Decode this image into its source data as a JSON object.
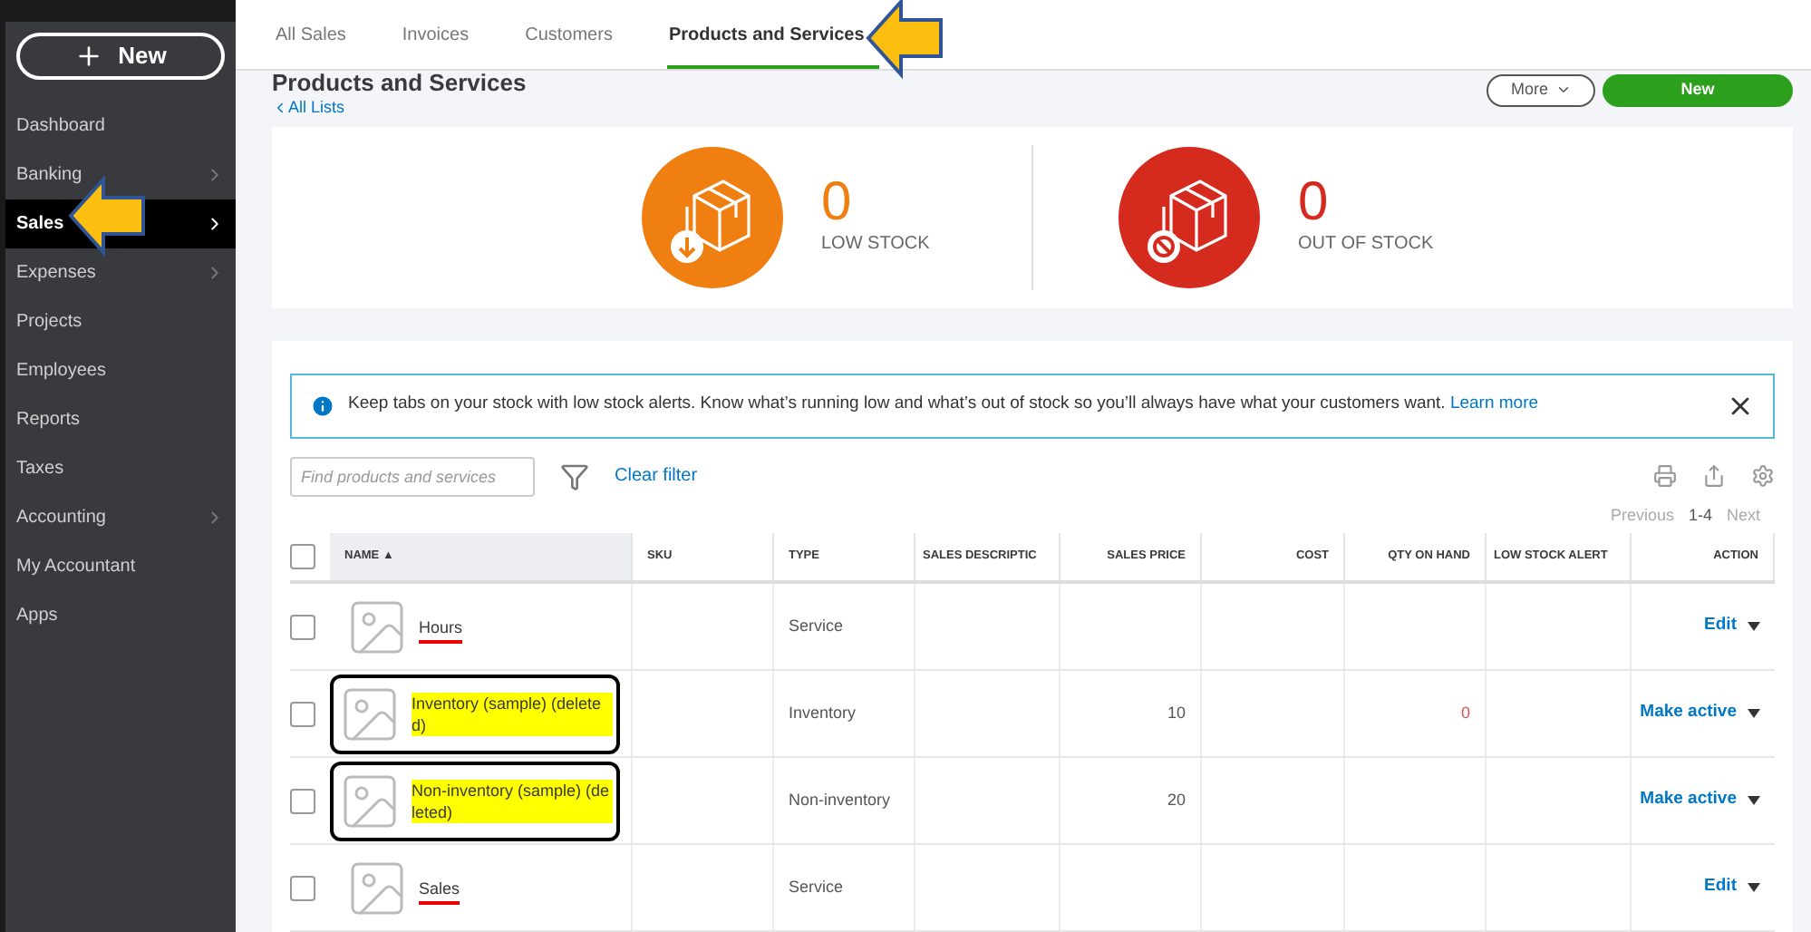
{
  "sidebar": {
    "new_button": "New",
    "items": [
      {
        "label": "Dashboard",
        "selected": false,
        "has_submenu": false,
        "arrow": false
      },
      {
        "label": "Banking",
        "selected": false,
        "has_submenu": true,
        "arrow": false
      },
      {
        "label": "Sales",
        "selected": true,
        "has_submenu": true,
        "arrow": true
      },
      {
        "label": "Expenses",
        "selected": false,
        "has_submenu": true,
        "arrow": false
      },
      {
        "label": "Projects",
        "selected": false,
        "has_submenu": false,
        "arrow": false
      },
      {
        "label": "Employees",
        "selected": false,
        "has_submenu": false,
        "arrow": false
      },
      {
        "label": "Reports",
        "selected": false,
        "has_submenu": false,
        "arrow": false
      },
      {
        "label": "Taxes",
        "selected": false,
        "has_submenu": false,
        "arrow": false
      },
      {
        "label": "Accounting",
        "selected": false,
        "has_submenu": true,
        "arrow": false
      },
      {
        "label": "My Accountant",
        "selected": false,
        "has_submenu": false,
        "arrow": false
      },
      {
        "label": "Apps",
        "selected": false,
        "has_submenu": false,
        "arrow": false
      }
    ]
  },
  "tabs": [
    {
      "label": "All Sales",
      "selected": false,
      "arrow": false
    },
    {
      "label": "Invoices",
      "selected": false,
      "arrow": false
    },
    {
      "label": "Customers",
      "selected": false,
      "arrow": false
    },
    {
      "label": "Products and Services",
      "selected": true,
      "arrow": true
    }
  ],
  "page": {
    "title": "Products and Services",
    "back_link": "All Lists",
    "more_button": "More",
    "new_button": "New"
  },
  "stock": [
    {
      "kind": "low",
      "count": "0",
      "label": "LOW STOCK"
    },
    {
      "kind": "out",
      "count": "0",
      "label": "OUT OF STOCK"
    }
  ],
  "alert": {
    "text": "Keep tabs on your stock with low stock alerts. Know what’s running low and what’s out of stock so you’ll always have what your customers want.",
    "link": "Learn more"
  },
  "search": {
    "placeholder": "Find products and services"
  },
  "clear_filter": "Clear filter",
  "pagination": {
    "previous": "Previous",
    "range": "1-4",
    "next": "Next"
  },
  "table": {
    "all_checked": false,
    "columns": [
      "NAME ▲",
      "SKU",
      "TYPE",
      "SALES DESCRIPTIC",
      "SALES PRICE",
      "COST",
      "QTY ON HAND",
      "LOW STOCK ALERT",
      "ACTION"
    ],
    "rows": [
      {
        "name": "Hours",
        "type": "Service",
        "action": "Edit",
        "checked": false,
        "kind": "underlined"
      },
      {
        "name": "Inventory (sample) (deleted)",
        "type": "Inventory",
        "price": "10",
        "qty": "0",
        "action": "Make active",
        "checked": false,
        "kind": "boxed"
      },
      {
        "name": "Non-inventory (sample) (deleted)",
        "type": "Non-inventory",
        "price": "20",
        "action": "Make active",
        "checked": false,
        "kind": "boxed"
      },
      {
        "name": "Sales",
        "type": "Service",
        "action": "Edit",
        "checked": false,
        "kind": "underlined"
      }
    ]
  }
}
